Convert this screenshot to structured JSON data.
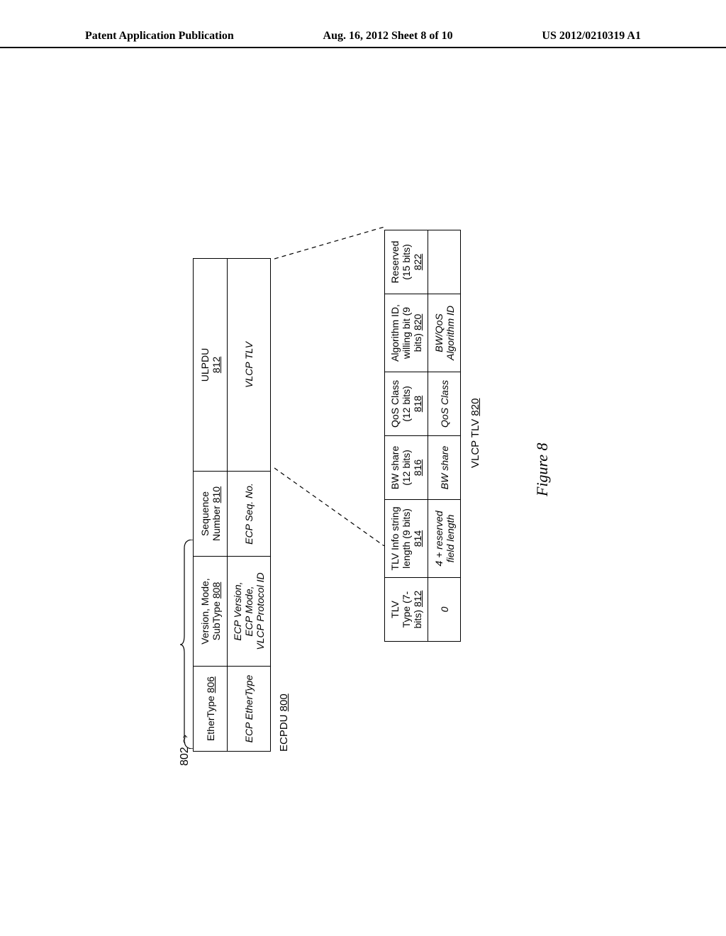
{
  "header": {
    "left": "Patent Application Publication",
    "center": "Aug. 16, 2012  Sheet 8 of 10",
    "right": "US 2012/0210319 A1"
  },
  "labels": {
    "l802": "802",
    "ecpdu": "ECPDU",
    "ecpdu_ref": "800",
    "vlcp_tlv": "VLCP TLV",
    "vlcp_ref": "820",
    "figure": "Figure 8"
  },
  "ecp": {
    "row1": {
      "c1a": "EtherType",
      "c1b": "806",
      "c2a": "Version, Mode,",
      "c2b": "SubType",
      "c2c": "808",
      "c3a": "Sequence",
      "c3b": "Number",
      "c3c": "810",
      "c4a": "ULPDU",
      "c4b": "812"
    },
    "row2": {
      "c1": "ECP EtherType",
      "c2a": "ECP Version,",
      "c2b": "ECP Mode,",
      "c2c": "VLCP Protocol ID",
      "c3": "ECP Seq. No.",
      "c4": "VLCP TLV"
    }
  },
  "tlv": {
    "row1": {
      "c1a": "TLV",
      "c1b": "Type (7-",
      "c1c": "bits)",
      "c1d": "812",
      "c2a": "TLV Info string",
      "c2b": "length (9 bits)",
      "c2c": "814",
      "c3a": "BW share",
      "c3b": "(12 bits)",
      "c3c": "816",
      "c4a": "QoS Class",
      "c4b": "(12 bits)",
      "c4c": "818",
      "c5a": "Algorithm ID,",
      "c5b": "willing bit (9",
      "c5c": "bits)",
      "c5d": "820",
      "c6a": "Reserved",
      "c6b": "(15 bits)",
      "c6c": "822"
    },
    "row2": {
      "c1": "0",
      "c2a": "4 + reserved",
      "c2b": "field length",
      "c3": "BW share",
      "c4": "QoS Class",
      "c5a": "BW/QoS",
      "c5b": "Algorithm ID"
    }
  }
}
